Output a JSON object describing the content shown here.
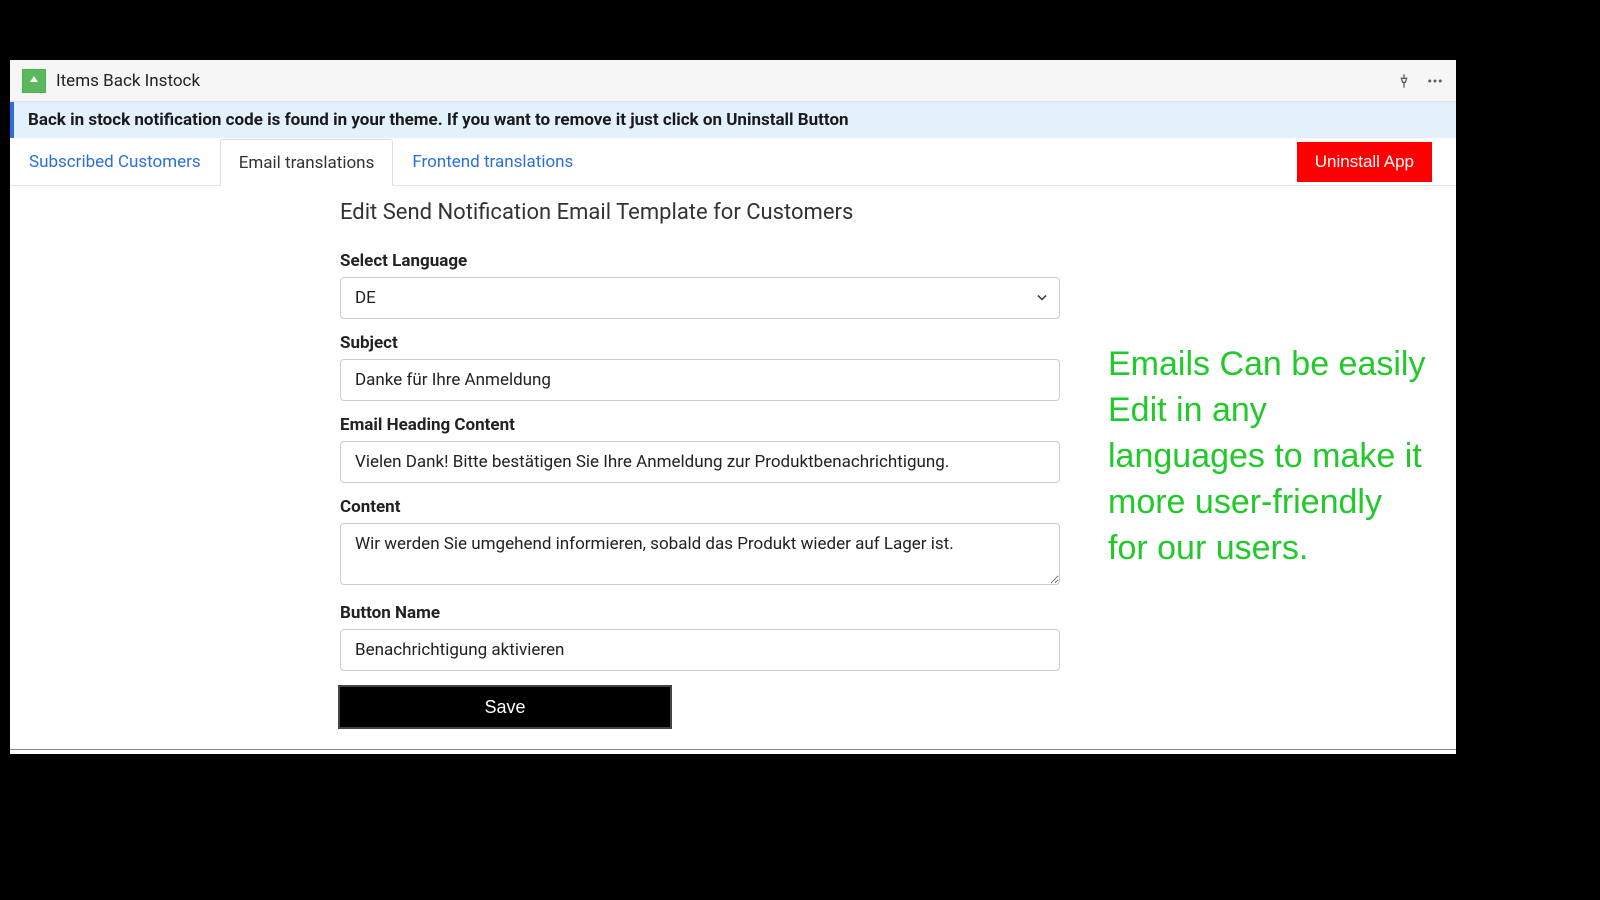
{
  "header": {
    "app_title": "Items Back Instock",
    "icon_name": "app-icon"
  },
  "banner": {
    "text": "Back in stock notification code is found in your theme. If you want to remove it just click on Uninstall Button"
  },
  "tabs": {
    "subscribed": "Subscribed Customers",
    "email_translations": "Email translations",
    "frontend_translations": "Frontend translations"
  },
  "actions": {
    "uninstall": "Uninstall App"
  },
  "page": {
    "heading": "Edit Send Notification Email Template for Customers"
  },
  "form": {
    "language_label": "Select Language",
    "language_value": "DE",
    "subject_label": "Subject",
    "subject_value": "Danke für Ihre Anmeldung",
    "heading_label": "Email Heading Content",
    "heading_value": "Vielen Dank! Bitte bestätigen Sie Ihre Anmeldung zur Produktbenachrichtigung.",
    "content_label": "Content",
    "content_value": "Wir werden Sie umgehend informieren, sobald das Produkt wieder auf Lager ist.",
    "button_name_label": "Button Name",
    "button_name_value": "Benachrichtigung aktivieren",
    "save_label": "Save"
  },
  "annotation": {
    "text": "Emails Can be easily Edit in any languages to make it more user-friendly for our users."
  },
  "colors": {
    "accent_link": "#2a6fdb",
    "danger": "#ff0000",
    "annotation_green": "#22c92b"
  }
}
